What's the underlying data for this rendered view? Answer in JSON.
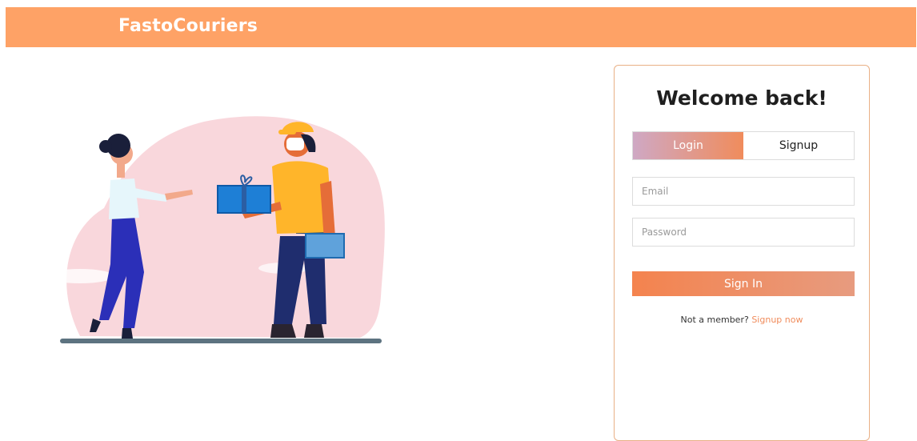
{
  "header": {
    "brand": "FastoCouriers"
  },
  "login_card": {
    "title": "Welcome back!",
    "tabs": [
      {
        "label": "Login",
        "active": true
      },
      {
        "label": "Signup",
        "active": false
      }
    ],
    "email": {
      "placeholder": "Email",
      "value": ""
    },
    "password": {
      "placeholder": "Password",
      "value": ""
    },
    "submit_label": "Sign In",
    "footer": {
      "prompt": "Not a member?",
      "link_label": "Signup now"
    }
  },
  "colors": {
    "navbar": "#fea266",
    "accent": "#f08c5c",
    "login_tab_gradient": [
      "#cfa8c4",
      "#f08c5c"
    ],
    "card_border": "#e9b086"
  },
  "illustration": {
    "subject": "delivery-courier-handing-package-to-woman"
  }
}
